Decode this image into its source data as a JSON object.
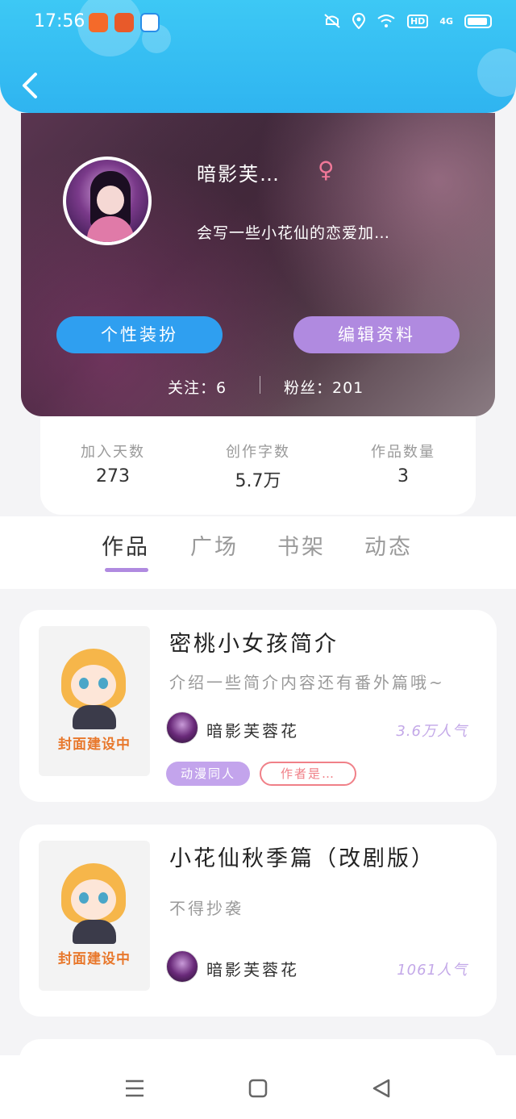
{
  "status_bar": {
    "time": "17:56",
    "icons": [
      "app-icon-orange",
      "app-icon-shop",
      "app-icon-browser",
      "mute-icon",
      "location-icon",
      "wifi-icon",
      "hd-icon",
      "4g-signal-icon",
      "battery-icon"
    ],
    "hd": "HD",
    "network": "4G"
  },
  "colors": {
    "header": "#2fb4f0",
    "accent_purple": "#b08ae0",
    "accent_blue": "#2f9ff0",
    "gender_pink": "#f07898",
    "tag_red": "#f08088"
  },
  "profile": {
    "name": "暗影芙…",
    "gender_symbol": "♀",
    "bio": "会写一些小花仙的恋爱加…",
    "style_button": "个性装扮",
    "edit_button": "编辑资料",
    "follow": "关注：6",
    "fans": "粉丝：201"
  },
  "stats": [
    {
      "label": "加入天数",
      "value": "273"
    },
    {
      "label": "创作字数",
      "value": "5.7万"
    },
    {
      "label": "作品数量",
      "value": "3"
    }
  ],
  "tabs": [
    {
      "label": "作品",
      "active": true
    },
    {
      "label": "广场",
      "active": false
    },
    {
      "label": "书架",
      "active": false
    },
    {
      "label": "动态",
      "active": false
    }
  ],
  "works": [
    {
      "title": "密桃小女孩简介",
      "description": "介绍一些简介内容还有番外篇哦~",
      "cover_text": "封面建设中",
      "author": "暗影芙蓉花",
      "count": "3.6万人气",
      "tags": [
        "动漫同人",
        "作者是…"
      ]
    },
    {
      "title": "小花仙秋季篇（改剧版）",
      "description": "不得抄袭",
      "cover_text": "封面建设中",
      "author": "暗影芙蓉花",
      "count": "1061人气",
      "tags": []
    }
  ]
}
